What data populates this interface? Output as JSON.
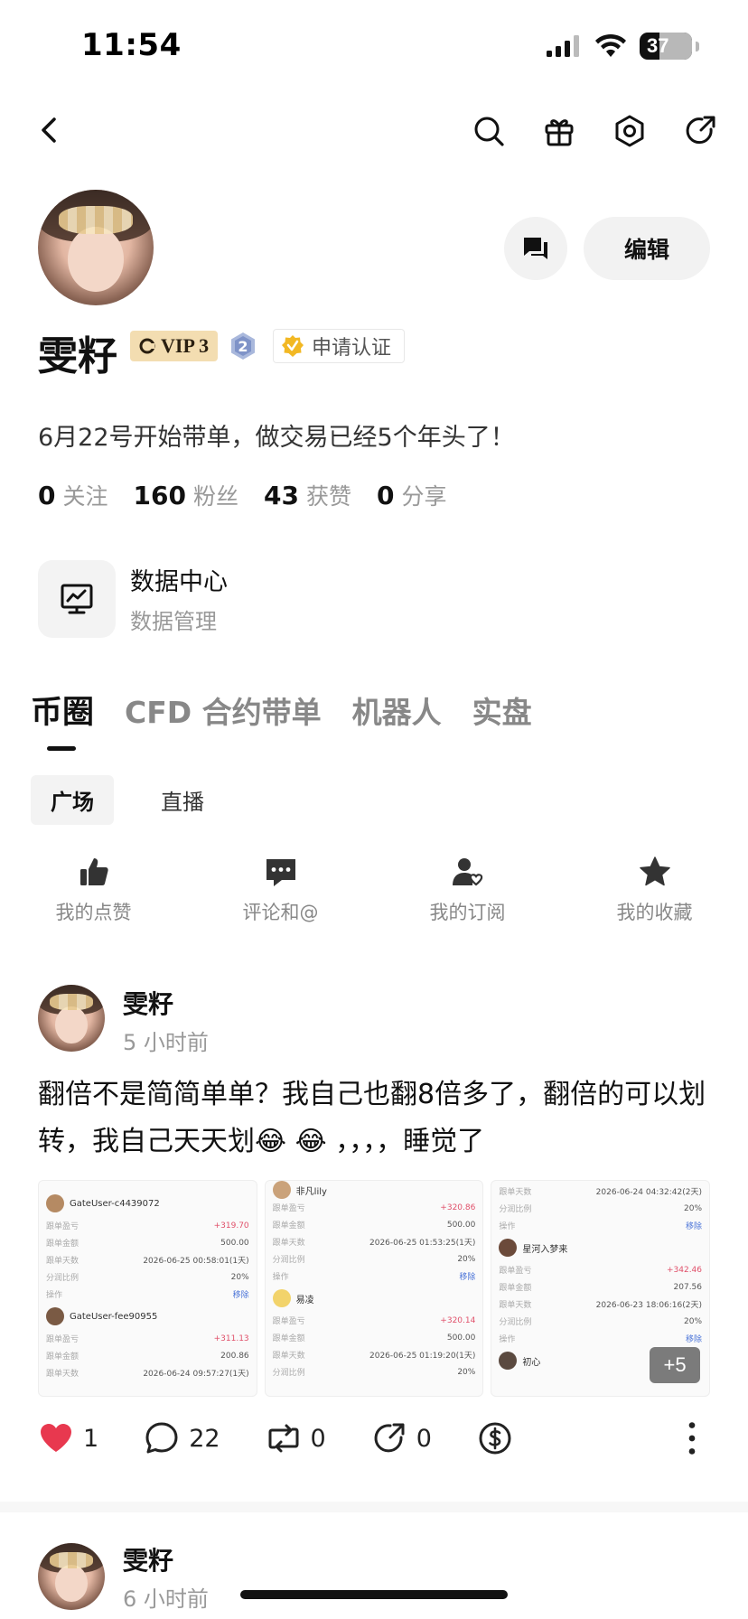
{
  "status_bar": {
    "time": "11:54",
    "battery": "37"
  },
  "nav": {
    "back_icon": "chevron-left-icon",
    "icons": [
      "search-icon",
      "gift-icon",
      "settings-icon",
      "share-icon"
    ]
  },
  "profile": {
    "name": "雯籽",
    "vip_label": "VIP 3",
    "level_badge": "2",
    "verify_label": "申请认证",
    "bio": "6月22号开始带单，做交易已经5个年头了！",
    "edit_label": "编辑",
    "stats": [
      {
        "num": "0",
        "label": "关注"
      },
      {
        "num": "160",
        "label": "粉丝"
      },
      {
        "num": "43",
        "label": "获赞"
      },
      {
        "num": "0",
        "label": "分享"
      }
    ]
  },
  "data_center": {
    "title": "数据中心",
    "subtitle": "数据管理"
  },
  "tabs": [
    "币圈",
    "CFD 合约带单",
    "机器人",
    "实盘"
  ],
  "sub_tabs": [
    "广场",
    "直播"
  ],
  "quick_actions": [
    {
      "label": "我的点赞",
      "icon": "thumbs-up-icon"
    },
    {
      "label": "评论和@",
      "icon": "comment-icon"
    },
    {
      "label": "我的订阅",
      "icon": "subscribe-icon"
    },
    {
      "label": "我的收藏",
      "icon": "star-icon"
    }
  ],
  "posts": [
    {
      "author": "雯籽",
      "time": "5 小时前",
      "text": "翻倍不是简简单单？我自己也翻8倍多了，翻倍的可以划转，我自己天天划😂 😂 ，，，，睡觉了",
      "images": [
        {
          "users": [
            "GateUser-c4439072",
            "GateUser-fee90955"
          ],
          "rows": [
            [
              "跟单盈亏",
              "+319.70"
            ],
            [
              "跟单金额",
              "500.00"
            ],
            [
              "跟单天数",
              "2026-06-25 00:58:01(1天)"
            ],
            [
              "分润比例",
              "20%"
            ],
            [
              "操作",
              "移除"
            ],
            [
              "跟单盈亏",
              "+311.13"
            ],
            [
              "跟单金额",
              "200.86"
            ],
            [
              "跟单天数",
              "2026-06-24 09:57:27(1天)"
            ]
          ]
        },
        {
          "users": [
            "非凡lily",
            "易凌"
          ],
          "rows": [
            [
              "跟单盈亏",
              "+320.86"
            ],
            [
              "跟单金额",
              "500.00"
            ],
            [
              "跟单天数",
              "2026-06-25 01:53:25(1天)"
            ],
            [
              "分润比例",
              "20%"
            ],
            [
              "操作",
              "移除"
            ],
            [
              "跟单盈亏",
              "+320.14"
            ],
            [
              "跟单金额",
              "500.00"
            ],
            [
              "跟单天数",
              "2026-06-25 01:19:20(1天)"
            ],
            [
              "分润比例",
              "20%"
            ]
          ]
        },
        {
          "users": [
            "星河入梦来",
            "初心"
          ],
          "rows": [
            [
              "跟单天数",
              "2026-06-24 04:32:42(2天)"
            ],
            [
              "分润比例",
              "20%"
            ],
            [
              "操作",
              "移除"
            ],
            [
              "跟单盈亏",
              "+342.46"
            ],
            [
              "跟单金额",
              "207.56"
            ],
            [
              "跟单天数",
              "2026-06-23 18:06:16(2天)"
            ],
            [
              "分润比例",
              "20%"
            ],
            [
              "操作",
              "移除"
            ]
          ],
          "more": "+5"
        }
      ],
      "likes": "1",
      "comments": "22",
      "reposts": "0",
      "shares": "0"
    },
    {
      "author": "雯籽",
      "time": "6 小时前"
    }
  ],
  "colors": {
    "like_red": "#e8384f",
    "vip_gold": "#f3ddb1"
  }
}
